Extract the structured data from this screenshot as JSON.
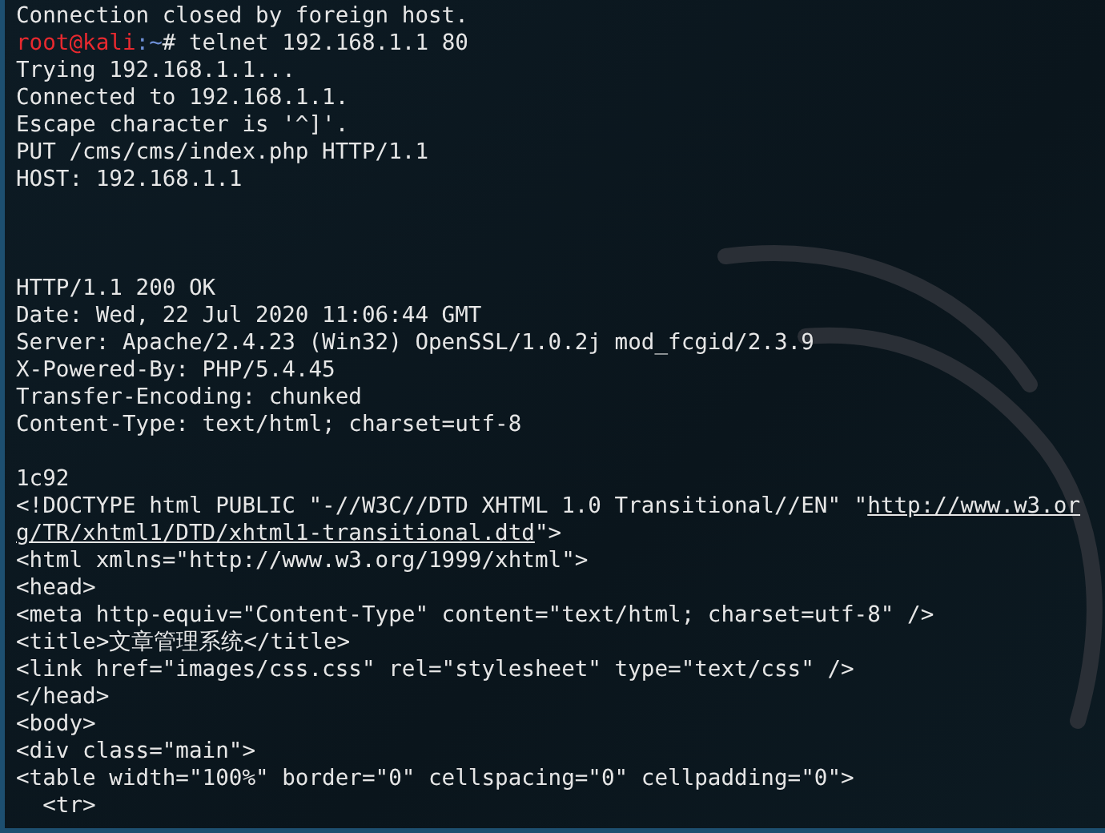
{
  "terminal": {
    "lines": [
      {
        "kind": "text",
        "segments": [
          {
            "kind": "plain",
            "text": "Connection closed by foreign host."
          }
        ]
      },
      {
        "kind": "text",
        "segments": [
          {
            "kind": "user",
            "text": "root@kali"
          },
          {
            "kind": "path",
            "text": ":~"
          },
          {
            "kind": "plain",
            "text": "# telnet 192.168.1.1 80"
          }
        ]
      },
      {
        "kind": "text",
        "segments": [
          {
            "kind": "plain",
            "text": "Trying 192.168.1.1..."
          }
        ]
      },
      {
        "kind": "text",
        "segments": [
          {
            "kind": "plain",
            "text": "Connected to 192.168.1.1."
          }
        ]
      },
      {
        "kind": "text",
        "segments": [
          {
            "kind": "plain",
            "text": "Escape character is '^]'."
          }
        ]
      },
      {
        "kind": "text",
        "segments": [
          {
            "kind": "plain",
            "text": "PUT /cms/cms/index.php HTTP/1.1"
          }
        ]
      },
      {
        "kind": "text",
        "segments": [
          {
            "kind": "plain",
            "text": "HOST: 192.168.1.1"
          }
        ]
      },
      {
        "kind": "blank"
      },
      {
        "kind": "blank"
      },
      {
        "kind": "blank"
      },
      {
        "kind": "text",
        "segments": [
          {
            "kind": "plain",
            "text": "HTTP/1.1 200 OK"
          }
        ]
      },
      {
        "kind": "text",
        "segments": [
          {
            "kind": "plain",
            "text": "Date: Wed, 22 Jul 2020 11:06:44 GMT"
          }
        ]
      },
      {
        "kind": "text",
        "segments": [
          {
            "kind": "plain",
            "text": "Server: Apache/2.4.23 (Win32) OpenSSL/1.0.2j mod_fcgid/2.3.9"
          }
        ]
      },
      {
        "kind": "text",
        "segments": [
          {
            "kind": "plain",
            "text": "X-Powered-By: PHP/5.4.45"
          }
        ]
      },
      {
        "kind": "text",
        "segments": [
          {
            "kind": "plain",
            "text": "Transfer-Encoding: chunked"
          }
        ]
      },
      {
        "kind": "text",
        "segments": [
          {
            "kind": "plain",
            "text": "Content-Type: text/html; charset=utf-8"
          }
        ]
      },
      {
        "kind": "blank"
      },
      {
        "kind": "text",
        "segments": [
          {
            "kind": "plain",
            "text": "1c92"
          }
        ]
      },
      {
        "kind": "text",
        "segments": [
          {
            "kind": "plain",
            "text": "<!DOCTYPE html PUBLIC \"-//W3C//DTD XHTML 1.0 Transitional//EN\" \""
          },
          {
            "kind": "link",
            "text": "http://www.w3.or"
          }
        ]
      },
      {
        "kind": "text",
        "segments": [
          {
            "kind": "link",
            "text": "g/TR/xhtml1/DTD/xhtml1-transitional.dtd"
          },
          {
            "kind": "plain",
            "text": "\">"
          }
        ]
      },
      {
        "kind": "text",
        "segments": [
          {
            "kind": "plain",
            "text": "<html xmlns=\"http://www.w3.org/1999/xhtml\">"
          }
        ]
      },
      {
        "kind": "text",
        "segments": [
          {
            "kind": "plain",
            "text": "<head>"
          }
        ]
      },
      {
        "kind": "text",
        "segments": [
          {
            "kind": "plain",
            "text": "<meta http-equiv=\"Content-Type\" content=\"text/html; charset=utf-8\" />"
          }
        ]
      },
      {
        "kind": "text",
        "segments": [
          {
            "kind": "plain",
            "text": "<title>文章管理系统</title>"
          }
        ]
      },
      {
        "kind": "text",
        "segments": [
          {
            "kind": "plain",
            "text": "<link href=\"images/css.css\" rel=\"stylesheet\" type=\"text/css\" />"
          }
        ]
      },
      {
        "kind": "text",
        "segments": [
          {
            "kind": "plain",
            "text": "</head>"
          }
        ]
      },
      {
        "kind": "text",
        "segments": [
          {
            "kind": "plain",
            "text": "<body>"
          }
        ]
      },
      {
        "kind": "text",
        "segments": [
          {
            "kind": "plain",
            "text": "<div class=\"main\">"
          }
        ]
      },
      {
        "kind": "text",
        "segments": [
          {
            "kind": "plain",
            "text": "<table width=\"100%\" border=\"0\" cellspacing=\"0\" cellpadding=\"0\">"
          }
        ]
      },
      {
        "kind": "text",
        "segments": [
          {
            "kind": "plain",
            "text": "  <tr>"
          }
        ]
      }
    ]
  }
}
